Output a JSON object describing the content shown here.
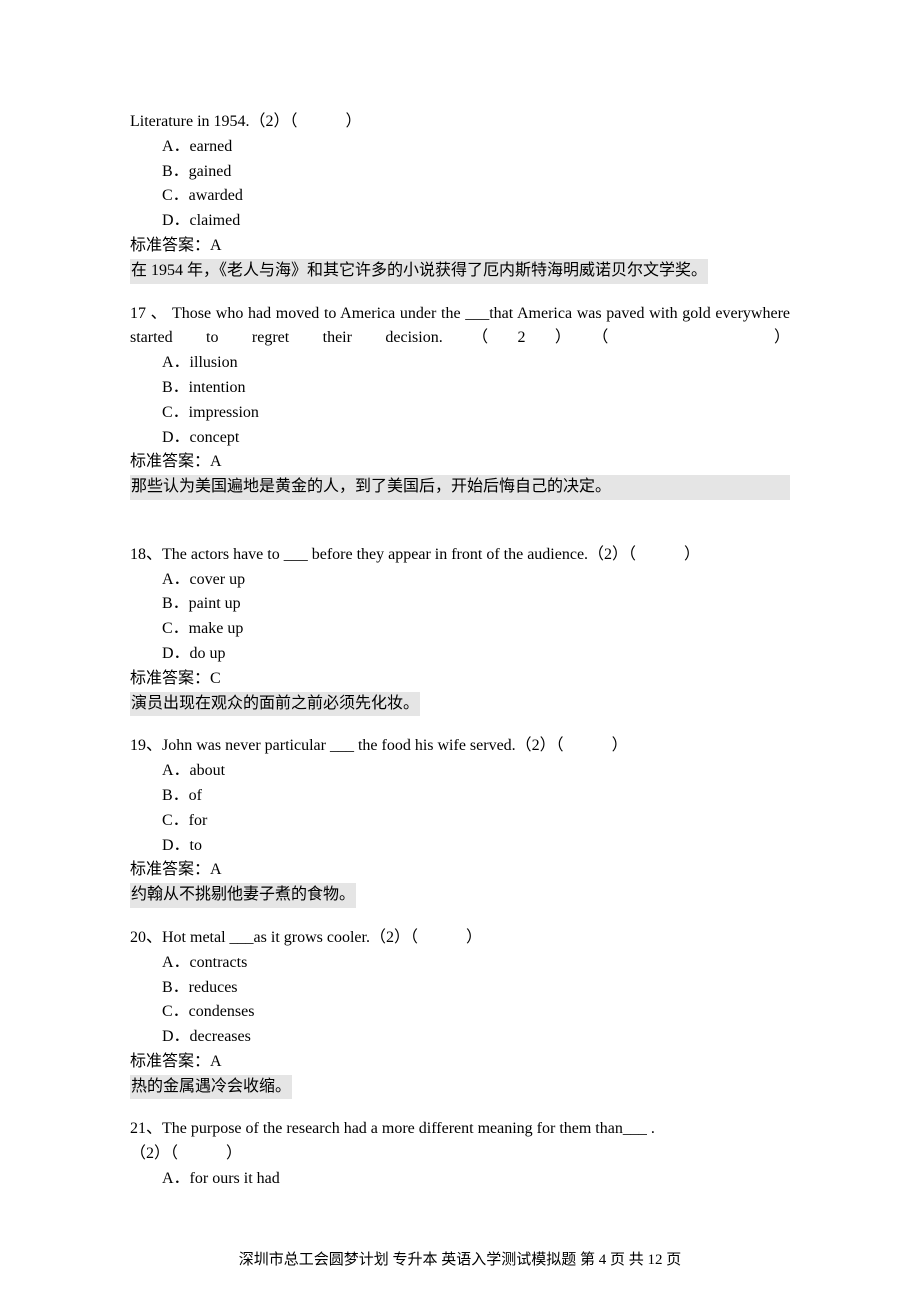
{
  "q16": {
    "stem_prefix": "Literature in 1954.（2）（　　　）",
    "options": {
      "a": "A．earned",
      "b": "B．gained",
      "c": "C．awarded",
      "d": "D．claimed"
    },
    "answer_label": "标准答案：A",
    "explanation": "在 1954 年，《老人与海》和其它许多的小说获得了厄内斯特海明威诺贝尔文学奖。"
  },
  "q17": {
    "stem": "17 、 Those who had moved to America under the ___that America was paved with gold everywhere started to regret their decision.（2）（　　　）",
    "options": {
      "a": "A．illusion",
      "b": "B．intention",
      "c": "C．impression",
      "d": "D．concept"
    },
    "answer_label": "标准答案：A",
    "explanation": "那些认为美国遍地是黄金的人，到了美国后，开始后悔自己的决定。"
  },
  "q18": {
    "stem": "18、The actors have to ___ before they appear in front of the audience.（2）（　　　）",
    "options": {
      "a": "A．cover up",
      "b": "B．paint up",
      "c": "C．make up",
      "d": "D．do up"
    },
    "answer_label": "标准答案：C",
    "explanation": "演员出现在观众的面前之前必须先化妆。"
  },
  "q19": {
    "stem": "19、John was never particular ___ the food his wife served.（2）（　　　）",
    "options": {
      "a": "A．about",
      "b": "B．of",
      "c": "C．for",
      "d": "D．to"
    },
    "answer_label": "标准答案：A",
    "explanation": "约翰从不挑剔他妻子煮的食物。"
  },
  "q20": {
    "stem": "20、Hot metal ___as it grows cooler.（2）（　　　）",
    "options": {
      "a": "A．contracts",
      "b": "B．reduces",
      "c": "C．condenses",
      "d": "D．decreases"
    },
    "answer_label": "标准答案：A",
    "explanation": "热的金属遇冷会收缩。"
  },
  "q21": {
    "stem_line1": "21、The purpose of the research had a more different meaning for them than___ .",
    "stem_line2": "（2）（　　　）",
    "options": {
      "a": "A．for ours it had"
    }
  },
  "footer": "深圳市总工会圆梦计划  专升本  英语入学测试模拟题  第  4  页  共  12  页"
}
